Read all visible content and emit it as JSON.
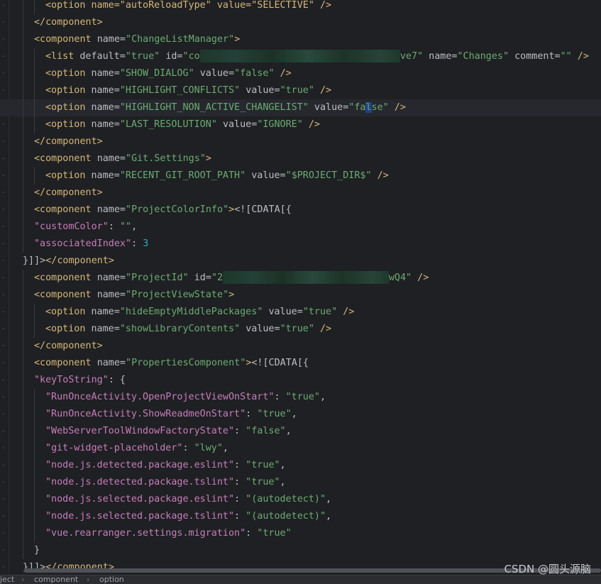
{
  "editor": {
    "lines": [
      {
        "type": "partial_top",
        "text": "<option name=\"autoReloadType\" value=\"SELECTIVE\" />"
      },
      {
        "type": "close",
        "text": "</component>"
      },
      {
        "type": "open_component",
        "name": "ChangeListManager"
      },
      {
        "type": "list",
        "id_start": "co",
        "id_end": "ve7",
        "name": "Changes",
        "comment": ""
      },
      {
        "type": "option",
        "name": "SHOW_DIALOG",
        "value": "false"
      },
      {
        "type": "option",
        "name": "HIGHLIGHT_CONFLICTS",
        "value": "true"
      },
      {
        "type": "option_caret",
        "name": "HIGHLIGHT_NON_ACTIVE_CHANGELIST",
        "value_a": "fa",
        "value_b": "l",
        "value_c": "se"
      },
      {
        "type": "option",
        "name": "LAST_RESOLUTION",
        "value": "IGNORE"
      },
      {
        "type": "close",
        "text": "</component>"
      },
      {
        "type": "open_component",
        "name": "Git.Settings"
      },
      {
        "type": "option",
        "name": "RECENT_GIT_ROOT_PATH",
        "value": "$PROJECT_DIR$"
      },
      {
        "type": "close",
        "text": "</component>"
      },
      {
        "type": "cdata_open",
        "name": "ProjectColorInfo"
      },
      {
        "type": "json_kv",
        "key": "\"customColor\"",
        "val": "\"\"",
        "trail": ","
      },
      {
        "type": "json_kv_num",
        "key": "\"associatedIndex\"",
        "val": "3"
      },
      {
        "type": "cdata_close",
        "text": "}]]></component>"
      },
      {
        "type": "project_id",
        "name": "ProjectId",
        "id_start": "2",
        "id_end": "wQ4"
      },
      {
        "type": "open_component",
        "name": "ProjectViewState"
      },
      {
        "type": "option",
        "name": "hideEmptyMiddlePackages",
        "value": "true"
      },
      {
        "type": "option",
        "name": "showLibraryContents",
        "value": "true"
      },
      {
        "type": "close",
        "text": "</component>"
      },
      {
        "type": "cdata_open",
        "name": "PropertiesComponent"
      },
      {
        "type": "json_obj",
        "key": "\"keyToString\""
      },
      {
        "type": "json_str",
        "key": "\"RunOnceActivity.OpenProjectViewOnStart\"",
        "val": "\"true\"",
        "trail": ","
      },
      {
        "type": "json_str",
        "key": "\"RunOnceActivity.ShowReadmeOnStart\"",
        "val": "\"true\"",
        "trail": ","
      },
      {
        "type": "json_str",
        "key": "\"WebServerToolWindowFactoryState\"",
        "val": "\"false\"",
        "trail": ","
      },
      {
        "type": "json_str",
        "key": "\"git-widget-placeholder\"",
        "val": "\"lwy\"",
        "trail": ","
      },
      {
        "type": "json_str",
        "key": "\"node.js.detected.package.eslint\"",
        "val": "\"true\"",
        "trail": ","
      },
      {
        "type": "json_str",
        "key": "\"node.js.detected.package.tslint\"",
        "val": "\"true\"",
        "trail": ","
      },
      {
        "type": "json_str",
        "key": "\"node.js.selected.package.eslint\"",
        "val": "\"(autodetect)\"",
        "trail": ","
      },
      {
        "type": "json_str",
        "key": "\"node.js.selected.package.tslint\"",
        "val": "\"(autodetect)\"",
        "trail": ","
      },
      {
        "type": "json_str",
        "key": "\"vue.rearranger.settings.migration\"",
        "val": "\"true\"",
        "trail": ""
      },
      {
        "type": "json_close",
        "text": "}"
      },
      {
        "type": "cdata_close",
        "text": "}]]></component>"
      }
    ]
  },
  "statusbar": {
    "items": [
      "ject",
      "component",
      "option"
    ]
  },
  "watermark": "CSDN @圆头源脑",
  "colors": {
    "background": "#1f2023",
    "tag": "#d5b778",
    "string": "#6aab73",
    "json_key": "#c77dbb",
    "number": "#2aacb8"
  }
}
